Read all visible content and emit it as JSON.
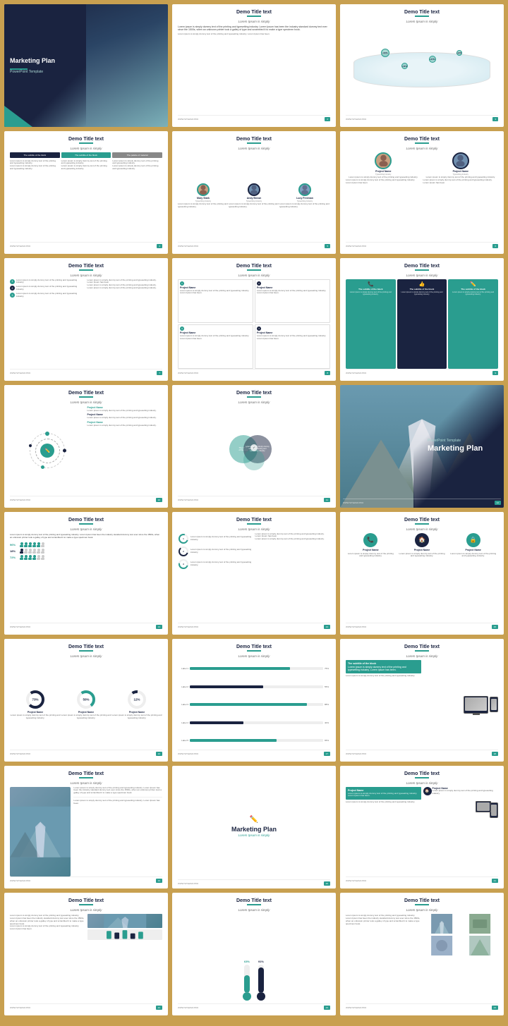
{
  "slides": [
    {
      "id": 1,
      "type": "cover",
      "title": "Marketing Plan",
      "subtitle": "PowerPoint Template"
    },
    {
      "id": 2,
      "type": "title-text",
      "title": "Demo Title text",
      "subtitle": "Lorem Ipsum is simply"
    },
    {
      "id": 3,
      "type": "world-map",
      "title": "Demo Title text",
      "subtitle": "Lorem Ipsum is simply",
      "stats": [
        "+96%",
        "+47%",
        "+12%",
        "+11%"
      ]
    },
    {
      "id": 4,
      "type": "tabs-list",
      "title": "Demo Title text",
      "subtitle": "Lorem Ipsum is simply",
      "tabs": [
        "The subtitle of the block",
        "The subtitle of the block",
        "The palette of material"
      ]
    },
    {
      "id": 5,
      "type": "profiles-3",
      "title": "Demo Title text",
      "subtitle": "Lorem Ipsum is simply",
      "profiles": [
        {
          "name": "Mary Stark",
          "role": "Typewriting Industry"
        },
        {
          "name": "Andy Brown",
          "role": "Typewriting Industry"
        },
        {
          "name": "Lucy Freeman",
          "role": "Typewriting Industry"
        }
      ]
    },
    {
      "id": 6,
      "type": "profiles-2",
      "title": "Demo Title text",
      "subtitle": "Lorem Ipsum is simply",
      "profiles": [
        {
          "name": "Project Name",
          "role": "Typewriting Industry"
        },
        {
          "name": "Project Name",
          "role": "Typewriting Industry"
        }
      ]
    },
    {
      "id": 7,
      "type": "bullet-list",
      "title": "Demo Title text",
      "subtitle": "Lorem Ipsum is simply",
      "items": [
        "1",
        "2",
        "3"
      ]
    },
    {
      "id": 8,
      "type": "project-cards",
      "title": "Demo Title text",
      "subtitle": "Lorem Ipsum is simply"
    },
    {
      "id": 9,
      "type": "icon-boxes",
      "title": "Demo Title text",
      "subtitle": "Lorem Ipsum is simply",
      "boxes": [
        {
          "icon": "📞",
          "title": "The subtitle of the block"
        },
        {
          "icon": "👍",
          "title": "The subtitle of the block"
        },
        {
          "icon": "✏️",
          "title": "The subtitle of the block"
        }
      ]
    },
    {
      "id": 10,
      "type": "circle-diagram",
      "title": "Demo Title text",
      "subtitle": "Lorem Ipsum is simply"
    },
    {
      "id": 11,
      "type": "venn",
      "title": "Demo Title text",
      "subtitle": "Lorem Ipsum is simply",
      "center_text": "The subtitle of the block"
    },
    {
      "id": 12,
      "type": "marketing-cover-2",
      "title": "Marketing Plan",
      "subtitle": "PowerPoint Template"
    },
    {
      "id": 13,
      "type": "people-stats",
      "title": "Demo Title text",
      "subtitle": "Lorem Ipsum is simply",
      "stats": [
        {
          "pct": "96%",
          "color": "#2a9d8f"
        },
        {
          "pct": "18%",
          "color": "#1a2340"
        },
        {
          "pct": "72%",
          "color": "#2a9d8f"
        }
      ]
    },
    {
      "id": 14,
      "type": "circle-icons",
      "title": "Demo Title text",
      "subtitle": "Lorem Ipsum is simply"
    },
    {
      "id": 15,
      "type": "icon-3-row",
      "title": "Demo Title text",
      "subtitle": "Lorem Ipsum is simply",
      "items": [
        {
          "icon": "📞",
          "name": "Project Name"
        },
        {
          "icon": "🏠",
          "name": "Project Name"
        },
        {
          "icon": "🔒",
          "name": "Project Name"
        }
      ]
    },
    {
      "id": 16,
      "type": "donut-3",
      "title": "Demo Title text",
      "subtitle": "Lorem Ipsum is simply",
      "donuts": [
        {
          "pct": "73%",
          "name": "Project Name"
        },
        {
          "pct": "50%",
          "name": "Project Name"
        },
        {
          "pct": "12%",
          "name": "Project Name"
        }
      ]
    },
    {
      "id": 17,
      "type": "bar-chart",
      "title": "Demo Title text",
      "subtitle": "Lorem Ipsum is simply"
    },
    {
      "id": 18,
      "type": "device-mockup",
      "title": "Demo Title text",
      "subtitle": "Lorem Ipsum is simply",
      "box_title": "The subtitle of the block"
    },
    {
      "id": 19,
      "type": "photo-text",
      "title": "Demo Title text",
      "subtitle": "Lorem Ipsum is simply"
    },
    {
      "id": 20,
      "type": "pencil-marketing",
      "title": "Marketing Plan",
      "subtitle": "Lorem Ipsum is simply"
    },
    {
      "id": 21,
      "type": "icon-text-2col",
      "title": "Demo Title text",
      "subtitle": "Lorem Ipsum is simply"
    },
    {
      "id": 22,
      "type": "text-long",
      "title": "Demo Title text",
      "subtitle": "Lorem Ipsum is simply"
    },
    {
      "id": 23,
      "type": "thermometer",
      "title": "Demo Title text",
      "subtitle": "Lorem Ipsum is simply",
      "values": [
        {
          "pct": 63,
          "label": "63%"
        },
        {
          "pct": 91,
          "label": "91%"
        }
      ]
    },
    {
      "id": 24,
      "type": "photo-thumbnails",
      "title": "Demo Title text",
      "subtitle": "Lorem Ipsum is simply"
    }
  ],
  "footer": {
    "url": "WWW.SITEZAR.PRO",
    "tagline": "Free PowerPoint & Keynote Templates",
    "badge": "8"
  },
  "colors": {
    "teal": "#2a9d8f",
    "dark_navy": "#1a2340",
    "light_gray": "#f5f5f5",
    "text_dark": "#333",
    "text_gray": "#666",
    "accent_orange": "#e76f51"
  },
  "lorem": "Lorem ipsum is simply dummy text of the printing and typesetting industry. Lorem Ipsum has been the industry standard dummy text ever since the 1500s, when an unknown printer took a galley of type and scrambled it to make a type specimen book.",
  "lorem_short": "Lorem ipsum is simply dummy text of the printing and typesetting industry. Lorem Ipsum has been.",
  "lorem_tiny": "Lorem ipsum is simply dummy text of the printing and typesetting industry."
}
